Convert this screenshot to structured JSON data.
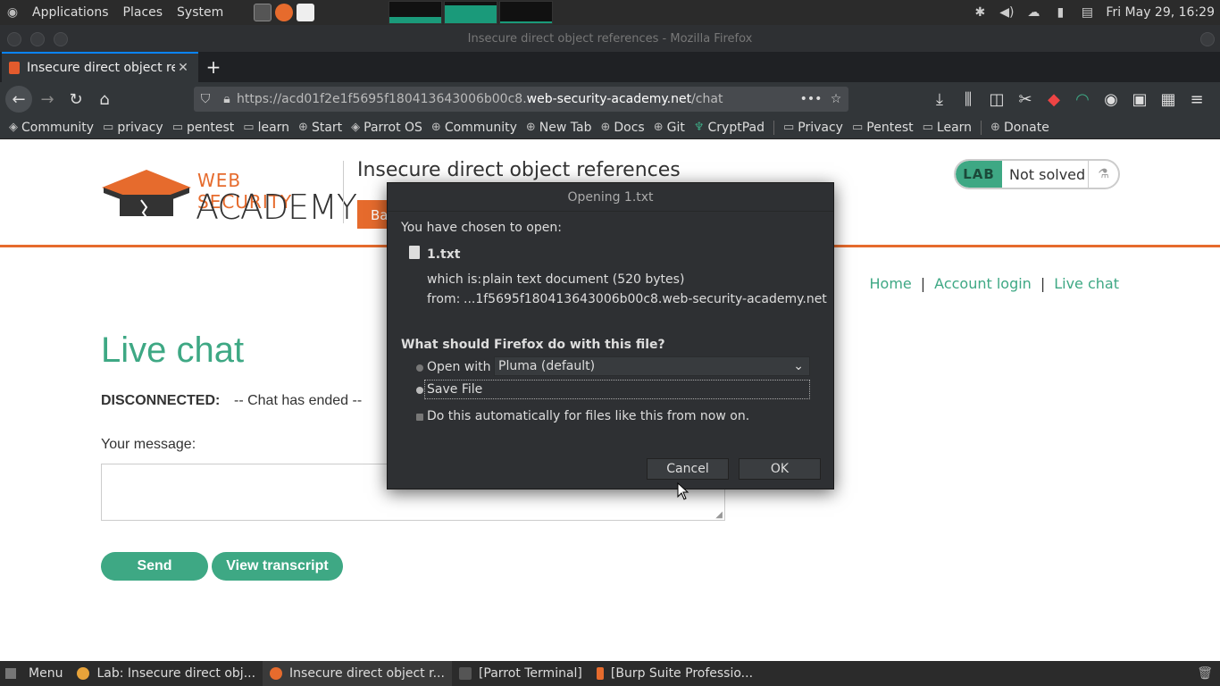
{
  "top_panel": {
    "menus": [
      "Applications",
      "Places",
      "System"
    ],
    "clock": "Fri May 29, 16:29"
  },
  "window": {
    "title": "Insecure direct object references - Mozilla Firefox"
  },
  "browser": {
    "tab_title": "Insecure direct object ref",
    "url_prefix": "https://acd01f2e1f5695f180413643006b00c8.",
    "url_host": "web-security-academy.net",
    "url_path": "/chat",
    "bookmarks": [
      "Community",
      "privacy",
      "pentest",
      "learn",
      "Start",
      "Parrot OS",
      "Community",
      "New Tab",
      "Docs",
      "Git",
      "CryptPad",
      "Privacy",
      "Pentest",
      "Learn",
      "Donate"
    ]
  },
  "page": {
    "logo_line1": "WEB SECURITY",
    "logo_line2": "ACADEMY",
    "lab_title": "Insecure direct object references",
    "back_link": "Ba",
    "lab_badge": "LAB",
    "lab_status": "Not solved",
    "nav": {
      "home": "Home",
      "sep": "|",
      "account_login": "Account login",
      "live_chat": "Live chat"
    },
    "heading": "Live chat",
    "disconnected_label": "DISCONNECTED:",
    "disconnected_msg": "-- Chat has ended --",
    "message_label": "Your message:",
    "send_button": "Send",
    "transcript_button": "View transcript"
  },
  "dialog": {
    "title": "Opening 1.txt",
    "intro": "You have chosen to open:",
    "filename": "1.txt",
    "which_is_label": "which is:",
    "which_is_value": "plain text document (520 bytes)",
    "from_label": "from:",
    "from_value": "...1f5695f180413643006b00c8.web-security-academy.net",
    "question": "What should Firefox do with this file?",
    "open_with_label": "Open with",
    "open_with_value": "Pluma (default)",
    "save_file_label": "Save File",
    "auto_label": "Do this automatically for files like this from now on.",
    "cancel": "Cancel",
    "ok": "OK",
    "selected_option": "Save File"
  },
  "taskbar": {
    "menu": "Menu",
    "tasks": [
      "Lab: Insecure direct obj...",
      "Insecure direct object r...",
      "[Parrot Terminal]",
      "[Burp Suite Professio..."
    ]
  },
  "colors": {
    "accent_green": "#3ea884",
    "accent_orange": "#e66b2d",
    "dialog_bg": "#2e3033"
  }
}
